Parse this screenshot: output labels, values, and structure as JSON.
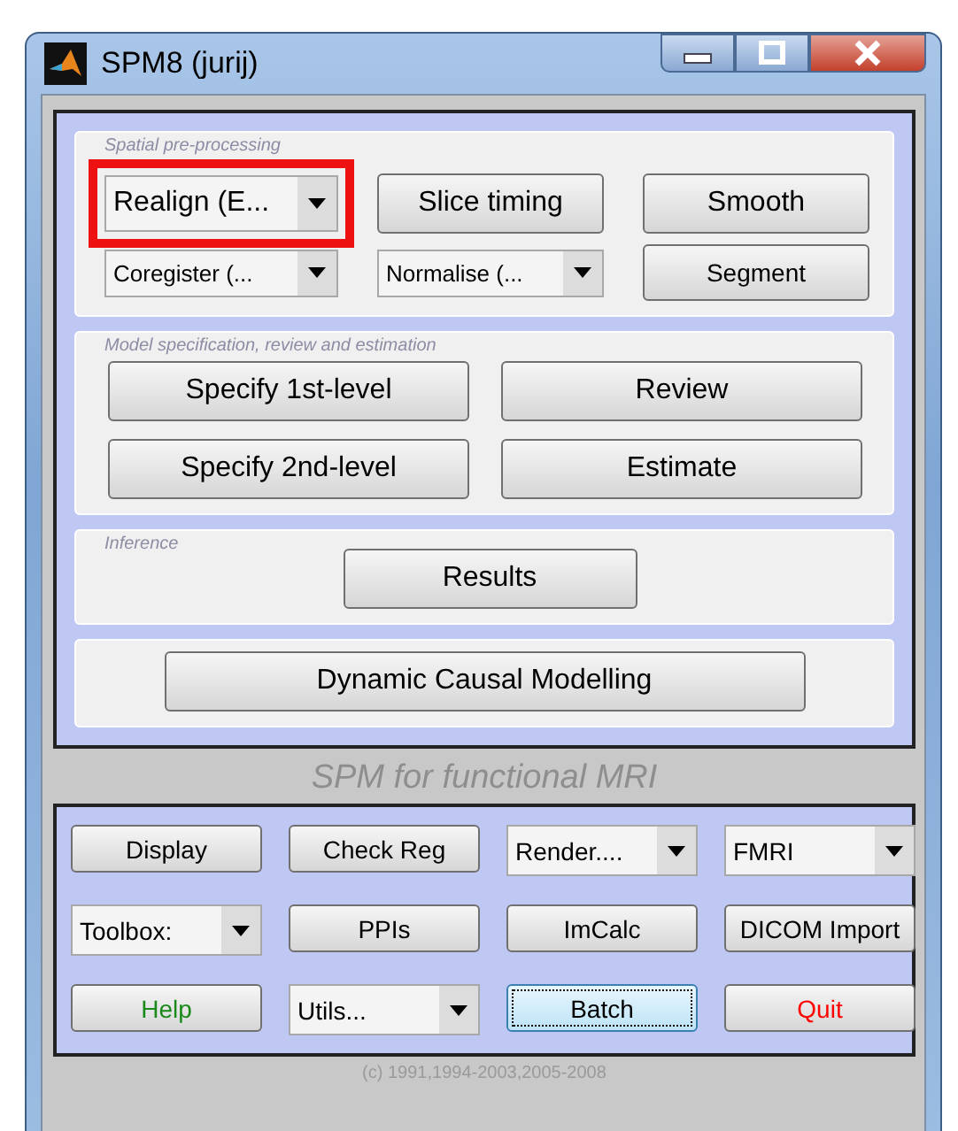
{
  "window": {
    "title": "SPM8 (jurij)"
  },
  "sections": [
    {
      "caption": "Spatial pre-processing",
      "kind": "grid3",
      "controls": [
        {
          "kind": "dropdown",
          "label": "Realign (E...",
          "highlighted": true
        },
        {
          "kind": "button",
          "label": "Slice timing"
        },
        {
          "kind": "button",
          "label": "Smooth"
        },
        {
          "kind": "dropdown",
          "label": "Coregister (..."
        },
        {
          "kind": "dropdown",
          "label": "Normalise (..."
        },
        {
          "kind": "button",
          "label": "Segment"
        }
      ]
    },
    {
      "caption": "Model specification, review and estimation",
      "kind": "grid2",
      "controls": [
        {
          "kind": "button",
          "label": "Specify 1st-level"
        },
        {
          "kind": "button",
          "label": "Review"
        },
        {
          "kind": "button",
          "label": "Specify 2nd-level"
        },
        {
          "kind": "button",
          "label": "Estimate"
        }
      ]
    },
    {
      "caption": "Inference",
      "kind": "single",
      "controls": [
        {
          "kind": "button",
          "label": "Results"
        }
      ]
    },
    {
      "kind": "wide",
      "controls": [
        {
          "kind": "button",
          "label": "Dynamic Causal Modelling"
        }
      ]
    }
  ],
  "subtitle": "SPM for functional MRI",
  "toolbar": [
    {
      "kind": "button",
      "label": "Display",
      "color": "#000000",
      "focused": false
    },
    {
      "kind": "button",
      "label": "Check Reg",
      "color": "#000000",
      "focused": false
    },
    {
      "kind": "dropdown",
      "label": "Render....",
      "color": "#000000"
    },
    {
      "kind": "dropdown",
      "label": "FMRI",
      "color": "#000000"
    },
    {
      "kind": "dropdown",
      "label": "Toolbox:",
      "color": "#000000"
    },
    {
      "kind": "button",
      "label": "PPIs",
      "color": "#000000",
      "focused": false
    },
    {
      "kind": "button",
      "label": "ImCalc",
      "color": "#000000",
      "focused": false
    },
    {
      "kind": "button",
      "label": "DICOM Import",
      "color": "#000000",
      "focused": false
    },
    {
      "kind": "button",
      "label": "Help",
      "color": "#1a8a1a",
      "focused": false
    },
    {
      "kind": "dropdown",
      "label": "Utils...",
      "color": "#000000"
    },
    {
      "kind": "button",
      "label": "Batch",
      "color": "#000000",
      "focused": true
    },
    {
      "kind": "button",
      "label": "Quit",
      "color": "#ff0000",
      "focused": false
    }
  ],
  "footer": "(c) 1991,1994-2003,2005-2008"
}
